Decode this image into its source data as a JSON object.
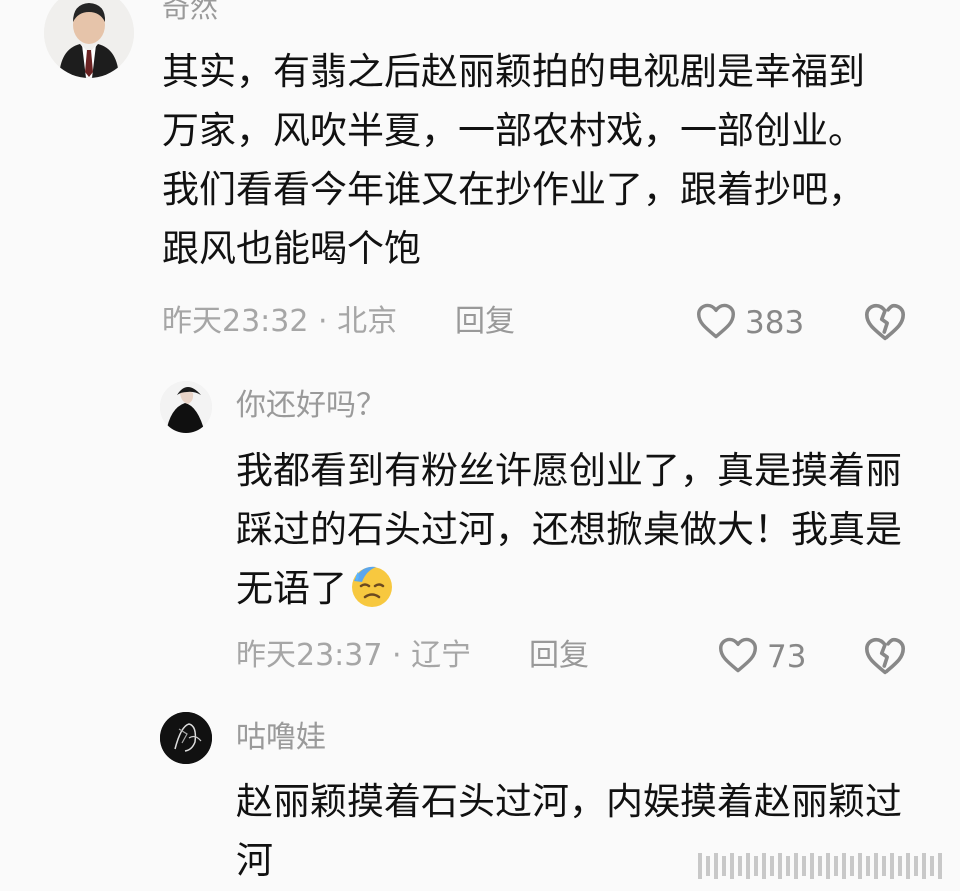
{
  "comments": [
    {
      "username": "奇然",
      "text": "其实，有翡之后赵丽颖拍的电视剧是幸福到万家，风吹半夏，一部农村戏，一部创业。我们看看今年谁又在抄作业了，跟着抄吧，跟风也能喝个饱",
      "meta": "昨天23:32 · 北京",
      "reply_label": "回复",
      "like_count": "383"
    },
    {
      "username": "你还好吗？",
      "text": "我都看到有粉丝许愿创业了，真是摸着丽踩过的石头过河，还想掀桌做大！我真是无语了",
      "emoji": "sweat-sad-face-emoji",
      "meta": "昨天23:37 · 辽宁",
      "reply_label": "回复",
      "like_count": "73"
    },
    {
      "username": "咕噜娃",
      "text": "赵丽颖摸着石头过河，内娱摸着赵丽颖过河"
    }
  ],
  "icons": {
    "like": "heart-outline-icon",
    "dislike": "broken-heart-icon"
  },
  "colors": {
    "background": "#fafafa",
    "text": "#111111",
    "muted": "#9a9a9a",
    "icon": "#8a8a8a"
  }
}
